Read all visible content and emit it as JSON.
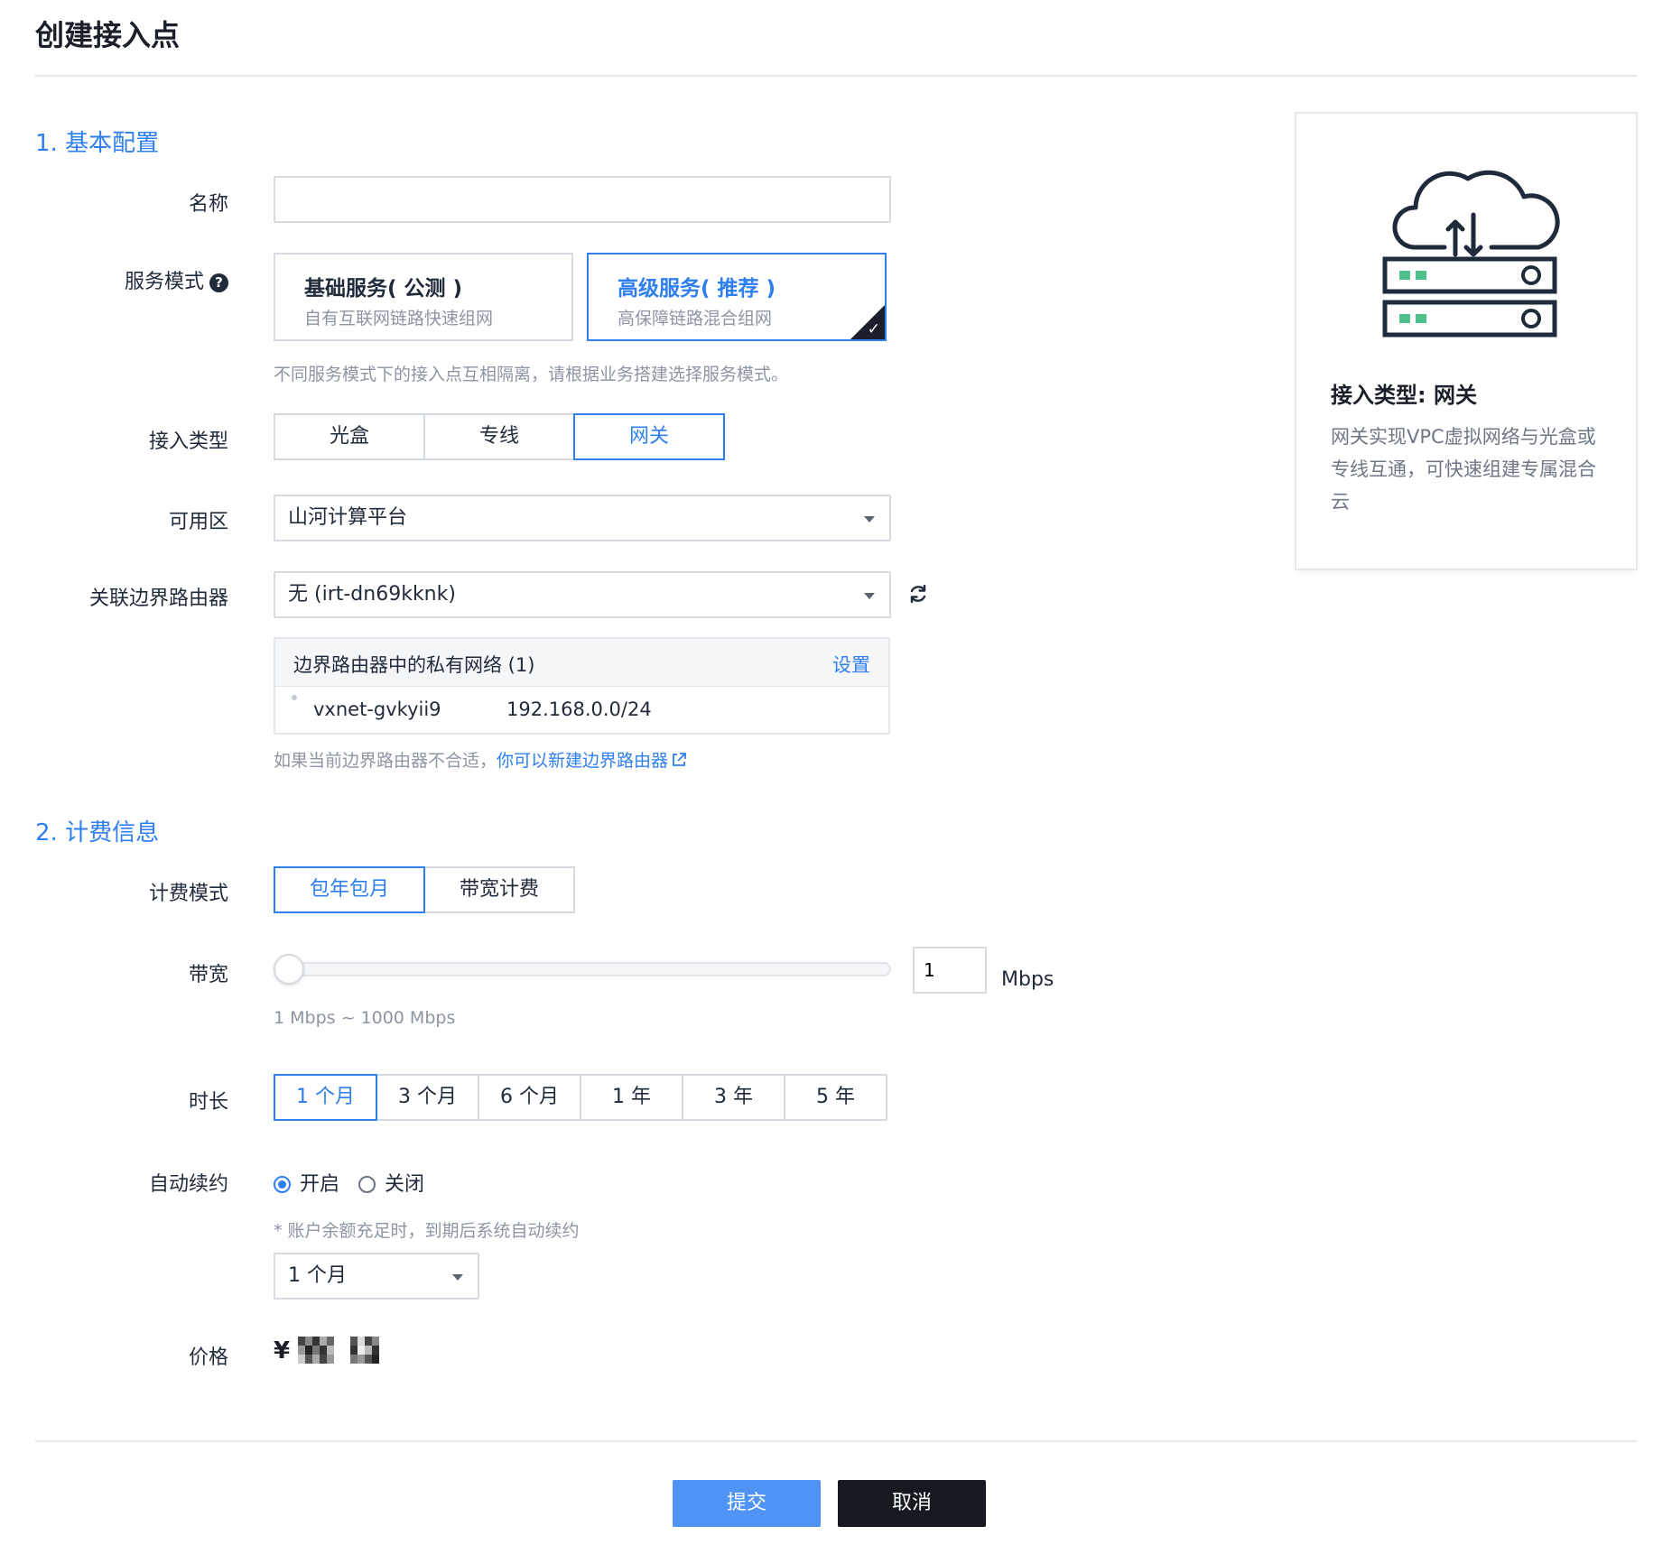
{
  "page": {
    "title": "创建接入点"
  },
  "sections": {
    "basic": "1. 基本配置",
    "billing": "2. 计费信息"
  },
  "form": {
    "name": {
      "label": "名称",
      "value": "",
      "placeholder": ""
    },
    "service_mode": {
      "label": "服务模式",
      "help_icon": "question-circle-icon",
      "options": [
        {
          "title": "基础服务( 公测 )",
          "subtitle": "自有互联网链路快速组网",
          "selected": false
        },
        {
          "title": "高级服务( 推荐 )",
          "subtitle": "高保障链路混合组网",
          "selected": true
        }
      ],
      "hint": "不同服务模式下的接入点互相隔离，请根据业务搭建选择服务模式。"
    },
    "access_type": {
      "label": "接入类型",
      "options": [
        "光盒",
        "专线",
        "网关"
      ],
      "selected": "网关"
    },
    "zone": {
      "label": "可用区",
      "value": "山河计算平台"
    },
    "border_router": {
      "label": "关联边界路由器",
      "value": "无 (irt-dn69kknk)",
      "refresh_icon": "refresh-icon",
      "panel_title": "边界路由器中的私有网络 (1)",
      "panel_action": "设置",
      "networks": [
        {
          "name": "vxnet-gvkyii9",
          "cidr": "192.168.0.0/24"
        }
      ],
      "hint_prefix": "如果当前边界路由器不合适，",
      "hint_link": "你可以新建边界路由器",
      "hint_icon": "external-link-icon"
    },
    "billing_mode": {
      "label": "计费模式",
      "options": [
        "包年包月",
        "带宽计费"
      ],
      "selected": "包年包月"
    },
    "bandwidth": {
      "label": "带宽",
      "value": "1",
      "unit": "Mbps",
      "range_hint": "1 Mbps ~ 1000 Mbps",
      "slider_fraction": 0.0
    },
    "duration": {
      "label": "时长",
      "options": [
        "1 个月",
        "3 个月",
        "6 个月",
        "1 年",
        "3 年",
        "5 年"
      ],
      "selected": "1 个月"
    },
    "auto_renew": {
      "label": "自动续约",
      "options": [
        "开启",
        "关闭"
      ],
      "selected": "开启",
      "hint": "* 账户余额充足时，到期后系统自动续约",
      "period": "1 个月"
    },
    "price": {
      "label": "价格",
      "currency": "¥"
    }
  },
  "actions": {
    "submit": "提交",
    "cancel": "取消"
  },
  "info_card": {
    "illustration_icon": "cloud-gateway-icon",
    "title": "接入类型: 网关",
    "description": "网关实现VPC虚拟网络与光盒或专线互通，可快速组建专属混合云"
  },
  "colors": {
    "accent": "#2f7ff0",
    "dark": "#1b1f2a",
    "server_led": "#4fbf8c"
  }
}
